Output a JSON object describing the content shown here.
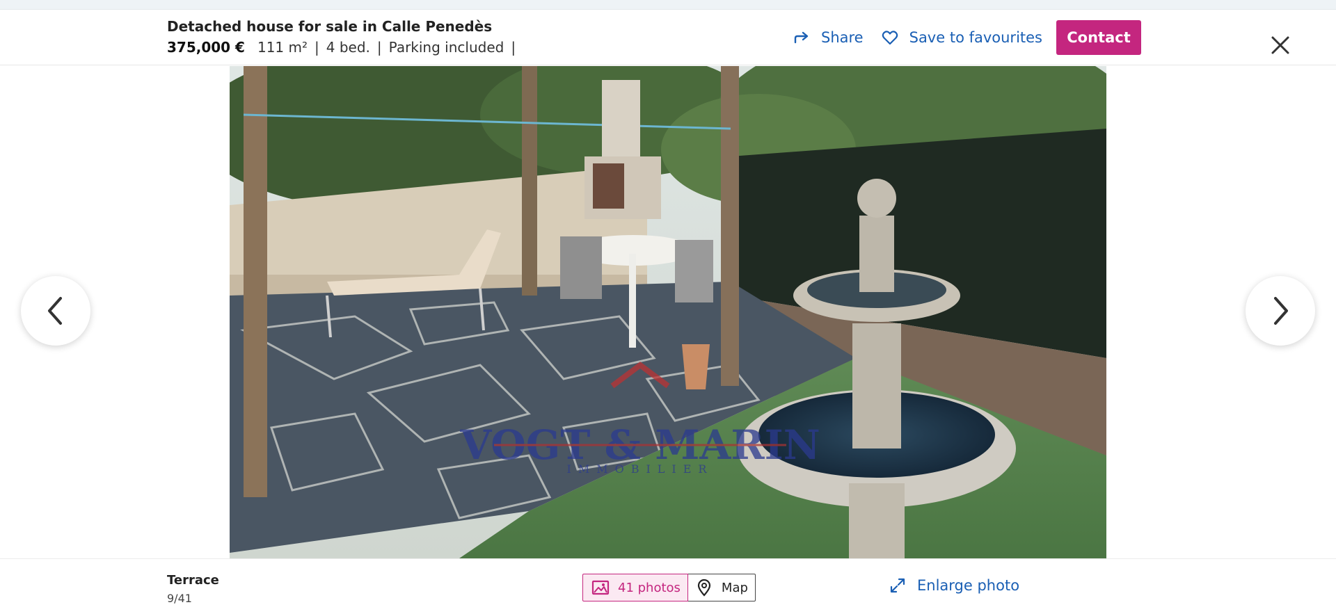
{
  "header": {
    "title": "Detached house for sale in Calle Penedès",
    "price": "375,000 €",
    "features": [
      "111 m²",
      "4 bed.",
      "Parking included"
    ],
    "separator": "|",
    "share_label": "Share",
    "favourite_label": "Save to favourites",
    "contact_label": "Contact"
  },
  "photo": {
    "subject": "Terrace with stone fountain, dining table and sun lounger",
    "watermark_text": "VOGT & MARIN",
    "watermark_subtext": "IMMOBILIER"
  },
  "footer": {
    "caption": "Terrace",
    "counter": "9/41",
    "photos_label": "41 photos",
    "map_label": "Map",
    "enlarge_label": "Enlarge photo"
  },
  "icons": {
    "share": "share-arrow-icon",
    "favourite": "heart-icon",
    "close": "close-icon",
    "prev": "chevron-left-icon",
    "next": "chevron-right-icon",
    "photos": "image-icon",
    "map": "map-pin-icon",
    "enlarge": "expand-icon"
  },
  "colors": {
    "accent": "#c4267f",
    "link": "#1a5fb4"
  }
}
